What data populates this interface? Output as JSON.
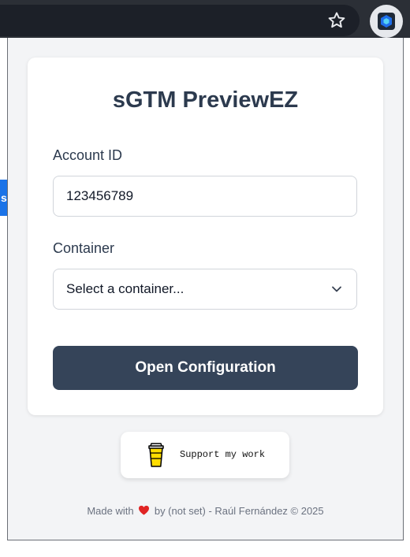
{
  "popup": {
    "title": "sGTM PreviewEZ",
    "account_label": "Account ID",
    "account_value": "123456789",
    "container_label": "Container",
    "container_selected": "Select a container...",
    "open_button_label": "Open Configuration"
  },
  "support": {
    "label": "Support my work",
    "icon": "coffee-cup-icon"
  },
  "footer": {
    "prefix": "Made with",
    "suffix": "by (not set) - Raúl Fernández © 2025",
    "icon": "heart-icon"
  },
  "browser": {
    "page_edge_text": "s",
    "icons": [
      "star-icon",
      "extension-icon"
    ]
  },
  "colors": {
    "primary": "#354459",
    "title": "#2c3a4e",
    "heart": "#e02424",
    "page_edge": "#1a73e8"
  }
}
